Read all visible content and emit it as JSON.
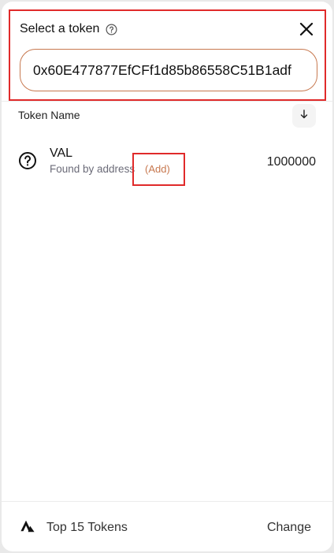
{
  "header": {
    "title": "Select a token"
  },
  "search": {
    "value": "0x60E477877EfCFf1d85b86558C51B1adf"
  },
  "list": {
    "column_header": "Token Name"
  },
  "tokens": [
    {
      "symbol": "VAL",
      "subtitle": "Found by address",
      "add_label": "(Add)",
      "balance": "1000000"
    }
  ],
  "footer": {
    "list_name": "Top 15 Tokens",
    "change_label": "Change"
  },
  "colors": {
    "accent": "#c7784f",
    "highlight": "#e02a2a"
  },
  "icons": {
    "help": "help-circle-icon",
    "close": "close-icon",
    "sort": "arrow-down-icon",
    "token": "question-circle-icon",
    "list": "token-list-logo-icon"
  }
}
